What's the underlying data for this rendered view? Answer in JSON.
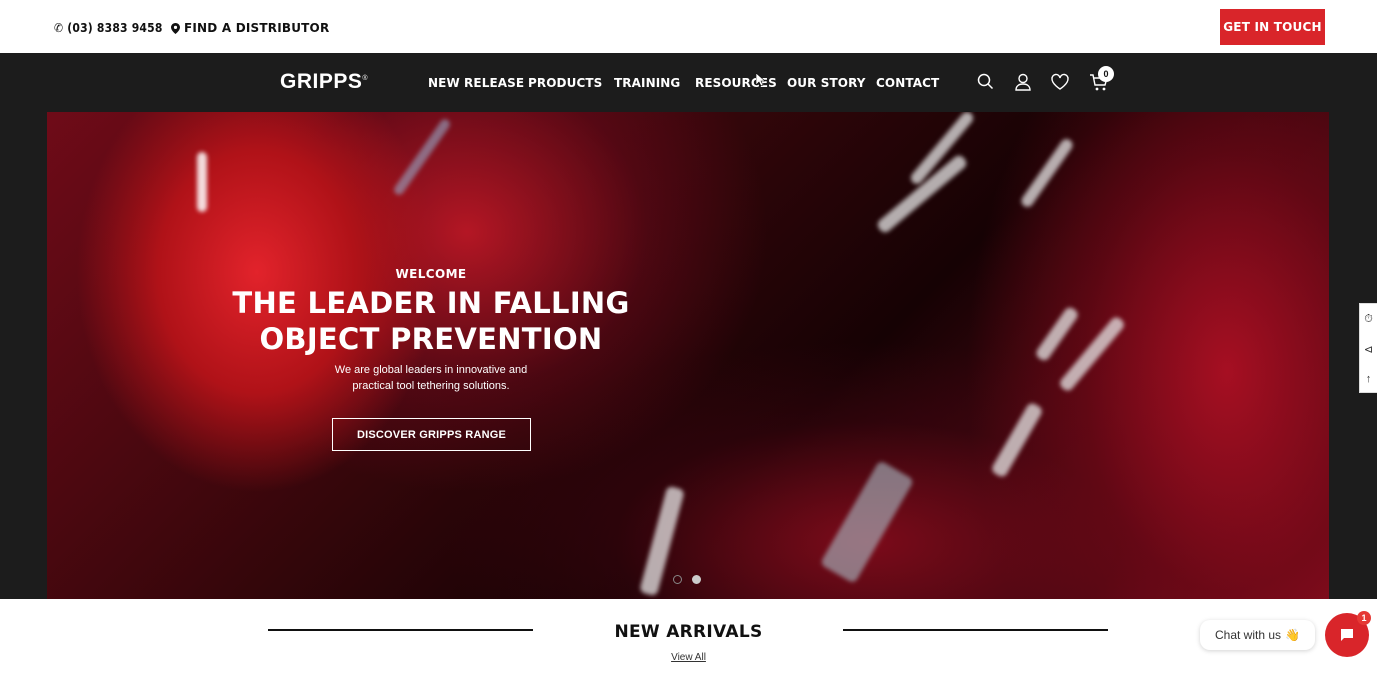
{
  "topbar": {
    "phone": "(03) 8383 9458",
    "distributor": "FIND A DISTRIBUTOR",
    "cta": "GET IN TOUCH"
  },
  "nav": {
    "logo": "GRIPPS",
    "items": [
      "NEW RELEASE",
      "PRODUCTS",
      "TRAINING",
      "RESOURCES",
      "OUR STORY",
      "CONTACT"
    ],
    "cart_count": "0",
    "icons": [
      "search-icon",
      "user-icon",
      "heart-icon",
      "cart-icon"
    ]
  },
  "hero": {
    "welcome": "WELCOME",
    "headline_line1": "THE LEADER IN FALLING",
    "headline_line2": "OBJECT PREVENTION",
    "sub_line1": "We are global leaders in innovative and",
    "sub_line2": "practical tool tethering solutions.",
    "button": "DISCOVER GRIPPS RANGE",
    "slides_total": 2,
    "active_slide": 2
  },
  "arrivals": {
    "title": "NEW ARRIVALS",
    "view_all": "View All"
  },
  "chat": {
    "label": "Chat with us",
    "badge": "1"
  },
  "colors": {
    "accent": "#d9252a",
    "nav_bg": "#1c1c1c"
  }
}
